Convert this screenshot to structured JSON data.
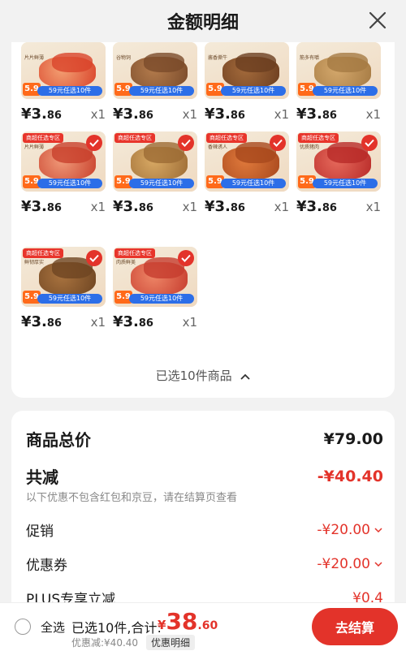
{
  "header": {
    "title": "金额明细"
  },
  "products": [
    {
      "row": 0,
      "col": 0,
      "price_int": "¥3.",
      "price_dec": "86",
      "qty": "x1",
      "selected": false,
      "colors": [
        "#d9432a",
        "#f3a073"
      ],
      "feat": "片片鲜薄",
      "promo": "59元任选10件"
    },
    {
      "row": 0,
      "col": 1,
      "price_int": "¥3.",
      "price_dec": "86",
      "qty": "x1",
      "selected": false,
      "colors": [
        "#7a4b2b",
        "#b37b4c"
      ],
      "feat": "谷物饲",
      "promo": "59元任选10件"
    },
    {
      "row": 0,
      "col": 2,
      "price_int": "¥3.",
      "price_dec": "86",
      "qty": "x1",
      "selected": false,
      "colors": [
        "#6c3e20",
        "#a36a3b"
      ],
      "feat": "酱香撕牛",
      "promo": "59元任选10件"
    },
    {
      "row": 0,
      "col": 3,
      "price_int": "¥3.",
      "price_dec": "86",
      "qty": "x1",
      "selected": false,
      "colors": [
        "#a57a43",
        "#d4a86c"
      ],
      "feat": "筋多有嚼",
      "promo": "59元任选10件"
    },
    {
      "row": 1,
      "col": 0,
      "price_int": "¥3.",
      "price_dec": "86",
      "qty": "x1",
      "selected": true,
      "colors": [
        "#c8402c",
        "#f09a79"
      ],
      "feat": "片片鲜薄",
      "promo": "59元任选10件"
    },
    {
      "row": 1,
      "col": 1,
      "price_int": "¥3.",
      "price_dec": "86",
      "qty": "x1",
      "selected": true,
      "colors": [
        "#9c6b34",
        "#d9aa65"
      ],
      "feat": "",
      "promo": "59元任选10件"
    },
    {
      "row": 1,
      "col": 2,
      "price_int": "¥3.",
      "price_dec": "86",
      "qty": "x1",
      "selected": true,
      "colors": [
        "#a8481d",
        "#e07a3c"
      ],
      "feat": "香辣诱人",
      "promo": "59元任选10件"
    },
    {
      "row": 1,
      "col": 3,
      "price_int": "¥3.",
      "price_dec": "86",
      "qty": "x1",
      "selected": true,
      "colors": [
        "#b82a28",
        "#e66a5c"
      ],
      "feat": "优质猪肉",
      "promo": "59元任选10件"
    },
    {
      "row": 2,
      "col": 0,
      "price_int": "¥3.",
      "price_dec": "86",
      "qty": "x1",
      "selected": true,
      "colors": [
        "#6e4522",
        "#a9733f"
      ],
      "feat": "鲜韧厚实",
      "promo": "59元任选10件"
    },
    {
      "row": 2,
      "col": 1,
      "price_int": "¥3.",
      "price_dec": "86",
      "qty": "x1",
      "selected": true,
      "colors": [
        "#c63c2e",
        "#ee8667"
      ],
      "feat": "肉质鲜美",
      "promo": "59元任选10件"
    }
  ],
  "badge": "5.9",
  "zone_tag": "商超任选专区",
  "selected_summary": "已选10件商品",
  "totals": {
    "goods_total_label": "商品总价",
    "goods_total_value": "¥79.00",
    "reduction_label": "共减",
    "reduction_value": "-¥40.40",
    "note": "以下优惠不包含红包和京豆，请在结算页查看",
    "promo_label": "促销",
    "promo_value": "-¥20.00",
    "coupon_label": "优惠券",
    "coupon_value": "-¥20.00",
    "plus_label": "PLUS专享立减",
    "plus_value": "¥0.4"
  },
  "bottom": {
    "select_all": "全选",
    "selected_count": "已选10件,合计:",
    "total_sym": "¥",
    "total_int": "38",
    "total_dec": ".60",
    "discount": "优惠减:¥40.40",
    "detail_link": "优惠明细",
    "checkout": "去结算"
  },
  "colors": {
    "accent": "#e3332a"
  }
}
